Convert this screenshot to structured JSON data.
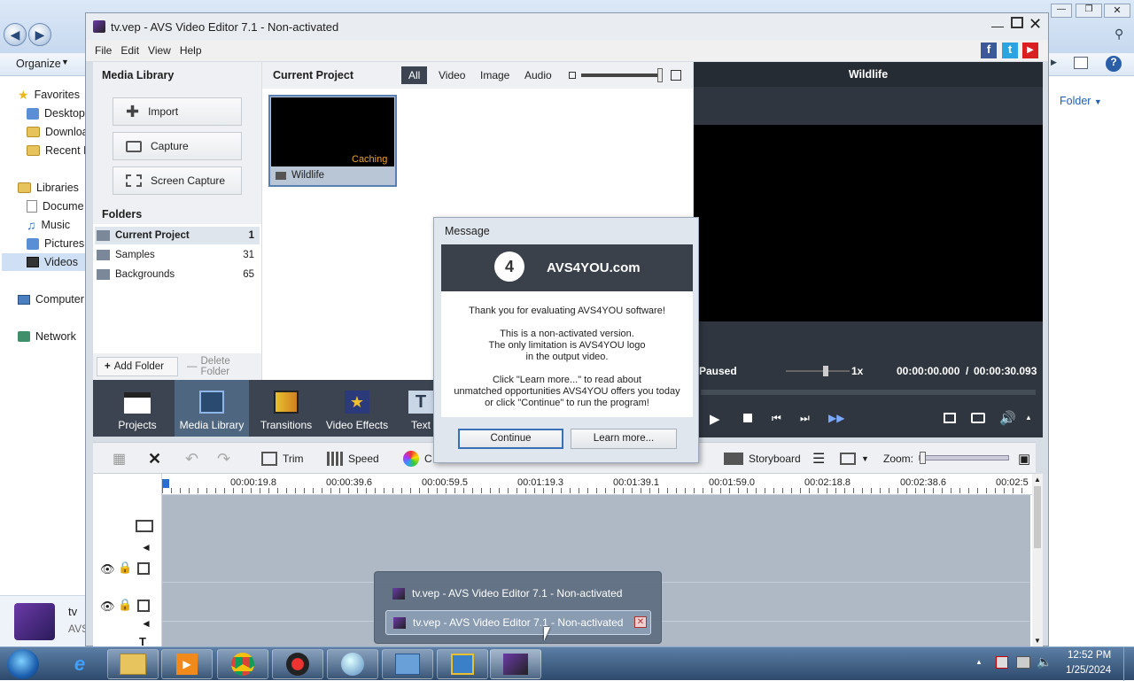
{
  "explorer": {
    "organize": "Organize",
    "folder_btn": "Folder",
    "favorites": "Favorites",
    "desktop": "Desktop",
    "downloads": "Downloa",
    "recent": "Recent P",
    "libraries": "Libraries",
    "documents": "Docume",
    "music": "Music",
    "pictures": "Pictures",
    "videos": "Videos",
    "computer": "Computer",
    "network": "Network",
    "file_name": "tv",
    "file_type": "AVS"
  },
  "app": {
    "title": "tv.vep - AVS Video Editor 7.1 - Non-activated",
    "menu": [
      "File",
      "Edit",
      "View",
      "Help"
    ],
    "media_library_title": "Media Library",
    "import": "Import",
    "capture": "Capture",
    "screen_capture": "Screen Capture",
    "folders_title": "Folders",
    "folders": [
      {
        "name": "Current Project",
        "count": "1"
      },
      {
        "name": "Samples",
        "count": "31"
      },
      {
        "name": "Backgrounds",
        "count": "65"
      }
    ],
    "add_folder": "Add Folder",
    "delete_folder": "Delete Folder",
    "current_project_title": "Current Project",
    "filter_tabs": [
      "All",
      "Video",
      "Image",
      "Audio"
    ],
    "clip_name": "Wildlife",
    "clip_status": "Caching",
    "tools": [
      "Projects",
      "Media Library",
      "Transitions",
      "Video Effects",
      "Text"
    ],
    "edit_tools": {
      "trim": "Trim",
      "speed": "Speed",
      "color": "C",
      "storyboard": "Storyboard",
      "zoom": "Zoom:"
    },
    "ruler_ticks": [
      "00:00:19.8",
      "00:00:39.6",
      "00:00:59.5",
      "00:01:19.3",
      "00:01:39.1",
      "00:01:59.0",
      "00:02:18.8",
      "00:02:38.6",
      "00:02:5"
    ]
  },
  "preview": {
    "title": "Wildlife",
    "state": "Paused",
    "speed": "1x",
    "time_current": "00:00:00.000",
    "time_sep": "/",
    "time_total": "00:00:30.093"
  },
  "message": {
    "title": "Message",
    "logo_text": "AVS4YOU.com",
    "line1": "Thank you for evaluating AVS4YOU software!",
    "line2": "This is a non-activated version.",
    "line3": "The only limitation is AVS4YOU logo",
    "line4": "in the output video.",
    "line5": "Click \"Learn more...\" to read about",
    "line6": "unmatched opportunities AVS4YOU offers you today",
    "line7": "or click \"Continue\" to run the program!",
    "continue": "Continue",
    "learn_more": "Learn more..."
  },
  "taskbar": {
    "thumb1": "tv.vep - AVS Video Editor 7.1 - Non-activated",
    "thumb2": "tv.vep - AVS Video Editor 7.1 - Non-activated",
    "time": "12:52 PM",
    "date": "1/25/2024"
  },
  "colors": {
    "accent": "#3b4450",
    "caching": "#f0a030",
    "selected": "#5a7fb3"
  }
}
